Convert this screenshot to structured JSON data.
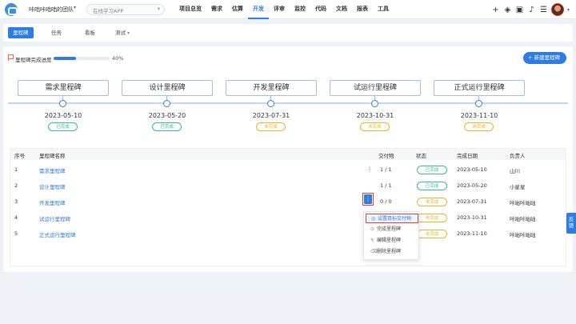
{
  "topbar": {
    "team_name": "咔咄咔咄咄的团队",
    "search_placeholder": "在线学习APP",
    "nav": [
      "项目总览",
      "需求",
      "估算",
      "开发",
      "评审",
      "监控",
      "代码",
      "文档",
      "报表",
      "工具"
    ],
    "active_nav": "开发",
    "icons": [
      "plus-icon",
      "layers-icon",
      "briefcase-icon",
      "bell-icon",
      "sliders-icon",
      "avatar"
    ]
  },
  "subtabs": {
    "items": [
      "里程碑",
      "任务",
      "看板",
      "测试"
    ],
    "active": "里程碑"
  },
  "progress": {
    "label": "里程碑完成进度",
    "value_text": "40%",
    "value": 0.4
  },
  "new_button": "新建里程碑",
  "milestones": [
    {
      "name": "需求里程碑",
      "date": "2023-05-10",
      "status": "已完成"
    },
    {
      "name": "设计里程碑",
      "date": "2023-05-20",
      "status": "已完成"
    },
    {
      "name": "开发里程碑",
      "date": "2023-07-31",
      "status": "未完成"
    },
    {
      "name": "试运行里程碑",
      "date": "2023-10-31",
      "status": "未完成"
    },
    {
      "name": "正式运行里程碑",
      "date": "2023-11-10",
      "status": "未完成"
    }
  ],
  "table": {
    "headers": [
      "序号",
      "里程碑名称",
      "交付物",
      "状态",
      "完成日期",
      "负责人"
    ],
    "rows": [
      {
        "idx": "1",
        "name": "需求里程碑",
        "deliverable": "1 / 1",
        "status": "已完成",
        "date": "2023-05-10",
        "owner": "山川"
      },
      {
        "idx": "2",
        "name": "设计里程碑",
        "deliverable": "1 / 1",
        "status": "已完成",
        "date": "2023-05-20",
        "owner": "小星星"
      },
      {
        "idx": "3",
        "name": "开发里程碑",
        "deliverable": "0 / 0",
        "status": "未完成",
        "date": "2023-07-31",
        "owner": "咔咄咔咄咄"
      },
      {
        "idx": "4",
        "name": "试运行里程碑",
        "deliverable": "",
        "status": "未完成",
        "date": "2023-10-31",
        "owner": "咔咄咔咄咄"
      },
      {
        "idx": "5",
        "name": "正式运行里程碑",
        "deliverable": "",
        "status": "未完成",
        "date": "2023-11-10",
        "owner": "咔咄咔咄咄"
      }
    ]
  },
  "row_menu": {
    "items": [
      "设置目标交付物",
      "完成里程碑",
      "编辑里程碑",
      "删除里程碑"
    ],
    "highlighted": "设置目标交付物"
  },
  "feedback_tab": "反馈",
  "colors": {
    "accent": "#2d7be5",
    "done": "#2bbf9a",
    "todo": "#f0b127",
    "highlight": "#e03b3b"
  }
}
